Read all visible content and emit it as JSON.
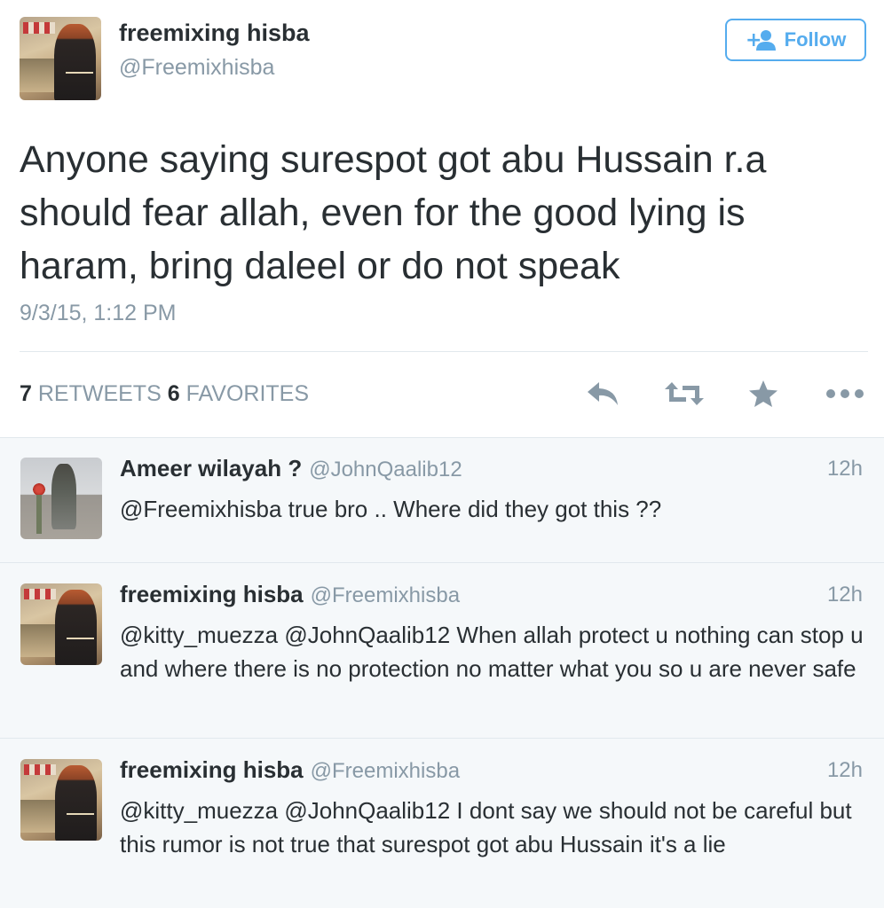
{
  "tweet": {
    "author_name": "freemixing hisba",
    "author_handle": "@Freemixhisba",
    "follow_label": "Follow",
    "text": "Anyone saying surespot got abu Hussain r.a should fear allah, even for the good lying is haram, bring daleel or do not speak",
    "timestamp": "9/3/15, 1:12 PM",
    "retweets_count": "7",
    "retweets_label": "RETWEETS",
    "favorites_count": "6",
    "favorites_label": "FAVORITES",
    "actions": {
      "reply_icon": "reply-icon",
      "retweet_icon": "retweet-icon",
      "favorite_icon": "star-icon",
      "more_icon": "more-dots-icon"
    }
  },
  "replies": [
    {
      "name": "Ameer wilayah ?",
      "handle": "@JohnQaalib12",
      "time": "12h",
      "text": "@Freemixhisba true bro .. Where did they got this ??"
    },
    {
      "name": "freemixing hisba",
      "handle": "@Freemixhisba",
      "time": "12h",
      "text": "@kitty_muezza @JohnQaalib12 When allah protect u nothing can stop u and where there is no protection no matter what you so u are never safe"
    },
    {
      "name": "freemixing hisba",
      "handle": "@Freemixhisba",
      "time": "12h",
      "text": "@kitty_muezza @JohnQaalib12 I dont say we should not be careful but this rumor is not true that surespot got abu Hussain it's a lie"
    }
  ],
  "colors": {
    "accent": "#55acee",
    "text_primary": "#292f33",
    "text_secondary": "#8899a6",
    "divider": "#e1e8ed",
    "reply_background": "#f5f8fa"
  }
}
